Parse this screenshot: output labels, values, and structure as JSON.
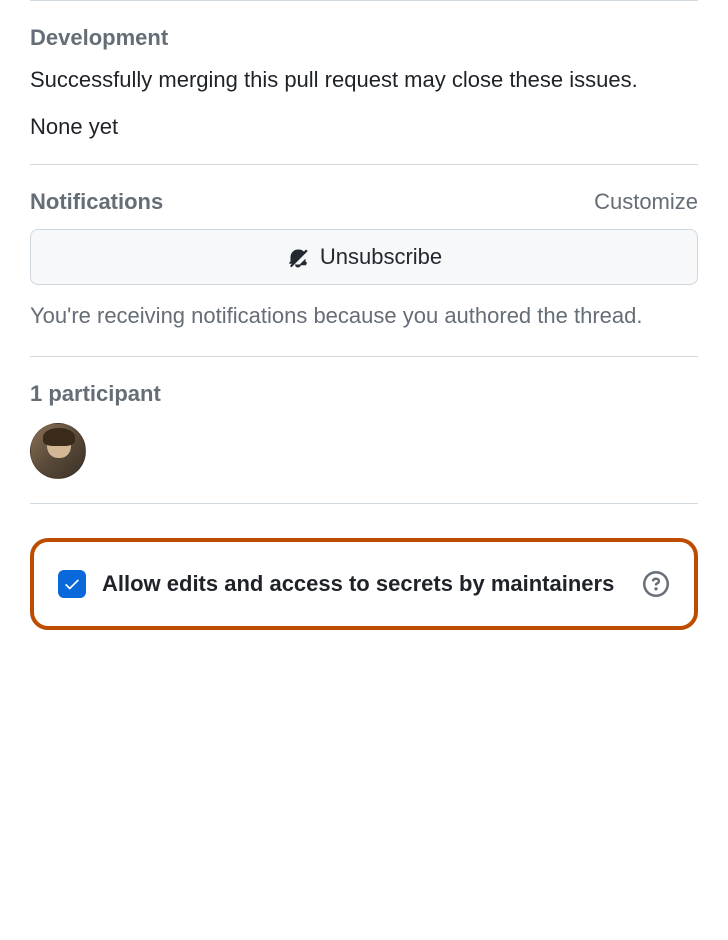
{
  "development": {
    "title": "Development",
    "description": "Successfully merging this pull request may close these issues.",
    "empty_state": "None yet"
  },
  "notifications": {
    "title": "Notifications",
    "customize_link": "Customize",
    "unsubscribe_label": "Unsubscribe",
    "reason": "You're receiving notifications because you authored the thread."
  },
  "participants": {
    "title": "1 participant"
  },
  "allow_edits": {
    "label": "Allow edits and access to secrets by maintainers",
    "checked": true
  }
}
